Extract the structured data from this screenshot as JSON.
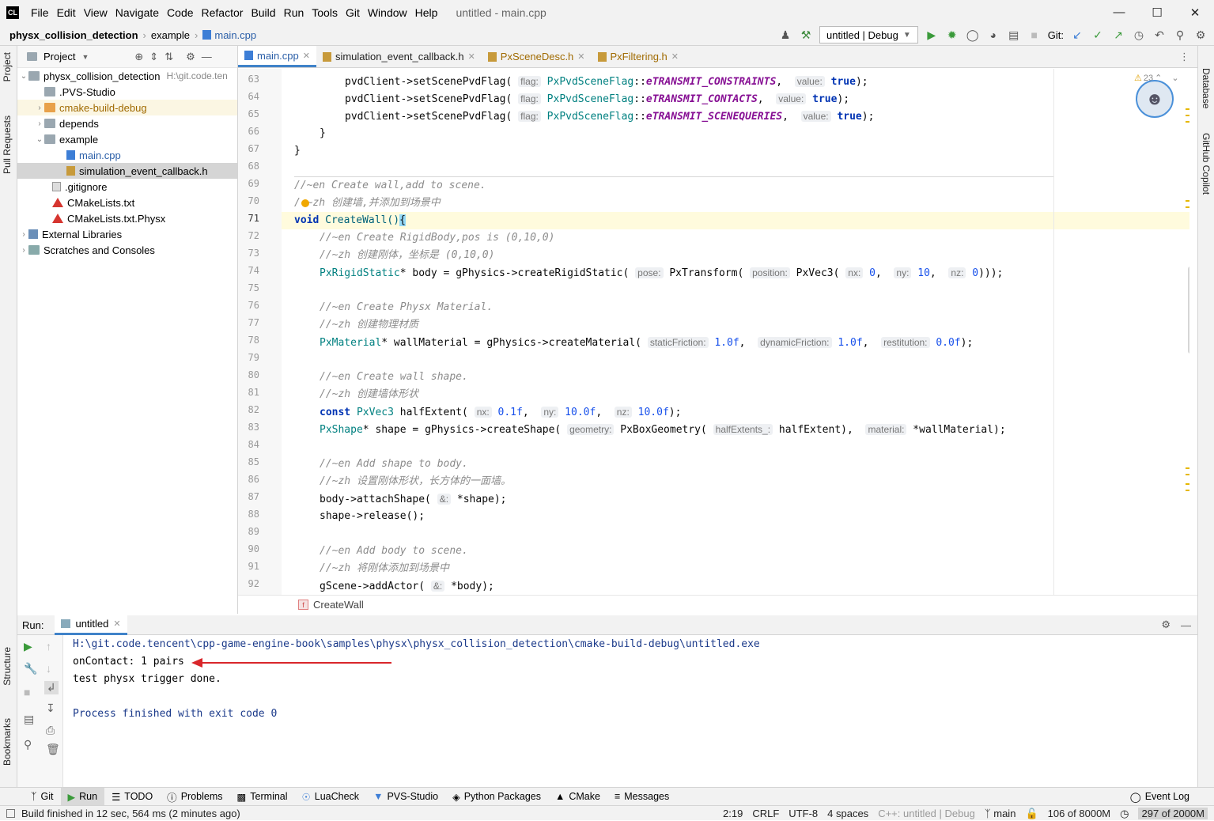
{
  "window": {
    "title": "untitled - main.cpp",
    "logo": "CL",
    "menu": [
      "File",
      "Edit",
      "View",
      "Navigate",
      "Code",
      "Refactor",
      "Build",
      "Run",
      "Tools",
      "Git",
      "Window",
      "Help"
    ]
  },
  "navbar": {
    "breadcrumb": [
      "physx_collision_detection",
      "example",
      "main.cpp"
    ],
    "run_config": "untitled | Debug",
    "git_label": "Git:"
  },
  "left_stripe": {
    "project": "Project",
    "pull_requests": "Pull Requests",
    "structure": "Structure",
    "bookmarks": "Bookmarks"
  },
  "right_stripe": {
    "database": "Database",
    "copilot": "GitHub Copilot"
  },
  "project_panel": {
    "title": "Project",
    "tree": [
      {
        "label": "physx_collision_detection",
        "extra": "H:\\git.code.ten"
      },
      {
        "label": ".PVS-Studio"
      },
      {
        "label": "cmake-build-debug"
      },
      {
        "label": "depends"
      },
      {
        "label": "example"
      },
      {
        "label": "main.cpp"
      },
      {
        "label": "simulation_event_callback.h"
      },
      {
        "label": ".gitignore"
      },
      {
        "label": "CMakeLists.txt"
      },
      {
        "label": "CMakeLists.txt.Physx"
      },
      {
        "label": "External Libraries"
      },
      {
        "label": "Scratches and Consoles"
      }
    ]
  },
  "editor_tabs": [
    "main.cpp",
    "simulation_event_callback.h",
    "PxSceneDesc.h",
    "PxFiltering.h"
  ],
  "editor": {
    "line_numbers": [
      "63",
      "64",
      "65",
      "66",
      "67",
      "68",
      "69",
      "70",
      "71",
      "72",
      "73",
      "74",
      "75",
      "76",
      "77",
      "78",
      "79",
      "80",
      "81",
      "82",
      "83",
      "84",
      "85",
      "86",
      "87",
      "88",
      "89",
      "90",
      "91",
      "92"
    ],
    "warning_count": "23",
    "bottom_breadcrumb": "CreateWall",
    "lines": {
      "l63": [
        "pvdClient->setScenePvdFlag(",
        "flag:",
        "PxPvdSceneFlag",
        "::",
        "eTRANSMIT_CONSTRAINTS",
        ",",
        "value:",
        "true",
        ");"
      ],
      "l64": [
        "pvdClient->setScenePvdFlag(",
        "flag:",
        "PxPvdSceneFlag",
        "::",
        "eTRANSMIT_CONTACTS",
        ",",
        "value:",
        "true",
        ");"
      ],
      "l65": [
        "pvdClient->setScenePvdFlag(",
        "flag:",
        "PxPvdSceneFlag",
        "::",
        "eTRANSMIT_SCENEQUERIES",
        ",",
        "value:",
        "true",
        ");"
      ],
      "l66": "}",
      "l67": "}",
      "l69": "//~en Create wall,add to scene.",
      "l70": "/ ~zh 创建墙,并添加到场景中",
      "l71": [
        "void",
        "CreateWall()",
        "{"
      ],
      "l72": "//~en Create RigidBody,pos is (0,10,0)",
      "l73": "//~zh 创建刚体，坐标是 (0,10,0)",
      "l74": [
        "PxRigidStatic",
        "* body = gPhysics->createRigidStatic(",
        "pose:",
        "PxTransform(",
        "position:",
        "PxVec3(",
        "nx:",
        "0",
        ",",
        "ny:",
        "10",
        ",",
        "nz:",
        "0",
        ")));"
      ],
      "l76": "//~en Create Physx Material.",
      "l77": "//~zh 创建物理材质",
      "l78": [
        "PxMaterial",
        "* wallMaterial = gPhysics->createMaterial(",
        "staticFriction:",
        "1.0f",
        ",",
        "dynamicFriction:",
        "1.0f",
        ",",
        "restitution:",
        "0.0f",
        ");"
      ],
      "l80": "//~en Create wall shape.",
      "l81": "//~zh 创建墙体形状",
      "l82": [
        "const",
        "PxVec3",
        "halfExtent(",
        "nx:",
        "0.1f",
        ",",
        "ny:",
        "10.0f",
        ",",
        "nz:",
        "10.0f",
        ");"
      ],
      "l83": [
        "PxShape",
        "* shape = gPhysics->createShape(",
        "geometry:",
        "PxBoxGeometry(",
        "halfExtents_:",
        "halfExtent),",
        "material:",
        "*wallMaterial);"
      ],
      "l85": "//~en Add shape to body.",
      "l86": "//~zh 设置刚体形状，长方体的一面墙。",
      "l87": [
        "body->attachShape(",
        "&:",
        "*shape);"
      ],
      "l88": "shape->release();",
      "l90": "//~en Add body to scene.",
      "l91": "//~zh 将刚体添加到场景中",
      "l92": [
        "gScene->addActor(",
        "&:",
        "*body);"
      ]
    }
  },
  "run_panel": {
    "label": "Run:",
    "tab": "untitled",
    "output": [
      "H:\\git.code.tencent\\cpp-game-engine-book\\samples\\physx\\physx_collision_detection\\cmake-build-debug\\untitled.exe",
      "onContact: 1 pairs",
      "test physx trigger done.",
      "",
      "Process finished with exit code 0"
    ]
  },
  "tool_tabs": [
    "Git",
    "Run",
    "TODO",
    "Problems",
    "Terminal",
    "LuaCheck",
    "PVS-Studio",
    "Python Packages",
    "CMake",
    "Messages"
  ],
  "event_log": "Event Log",
  "status": {
    "message": "Build finished in 12 sec, 564 ms (2 minutes ago)",
    "position": "2:19",
    "line_sep": "CRLF",
    "encoding": "UTF-8",
    "indent": "4 spaces",
    "context": "C++: untitled | Debug",
    "branch": "main",
    "memory1": "106 of 8000M",
    "memory2": "297 of 2000M"
  },
  "colors": {
    "accent": "#4083c9",
    "annotation_arrow": "#d9262b"
  }
}
